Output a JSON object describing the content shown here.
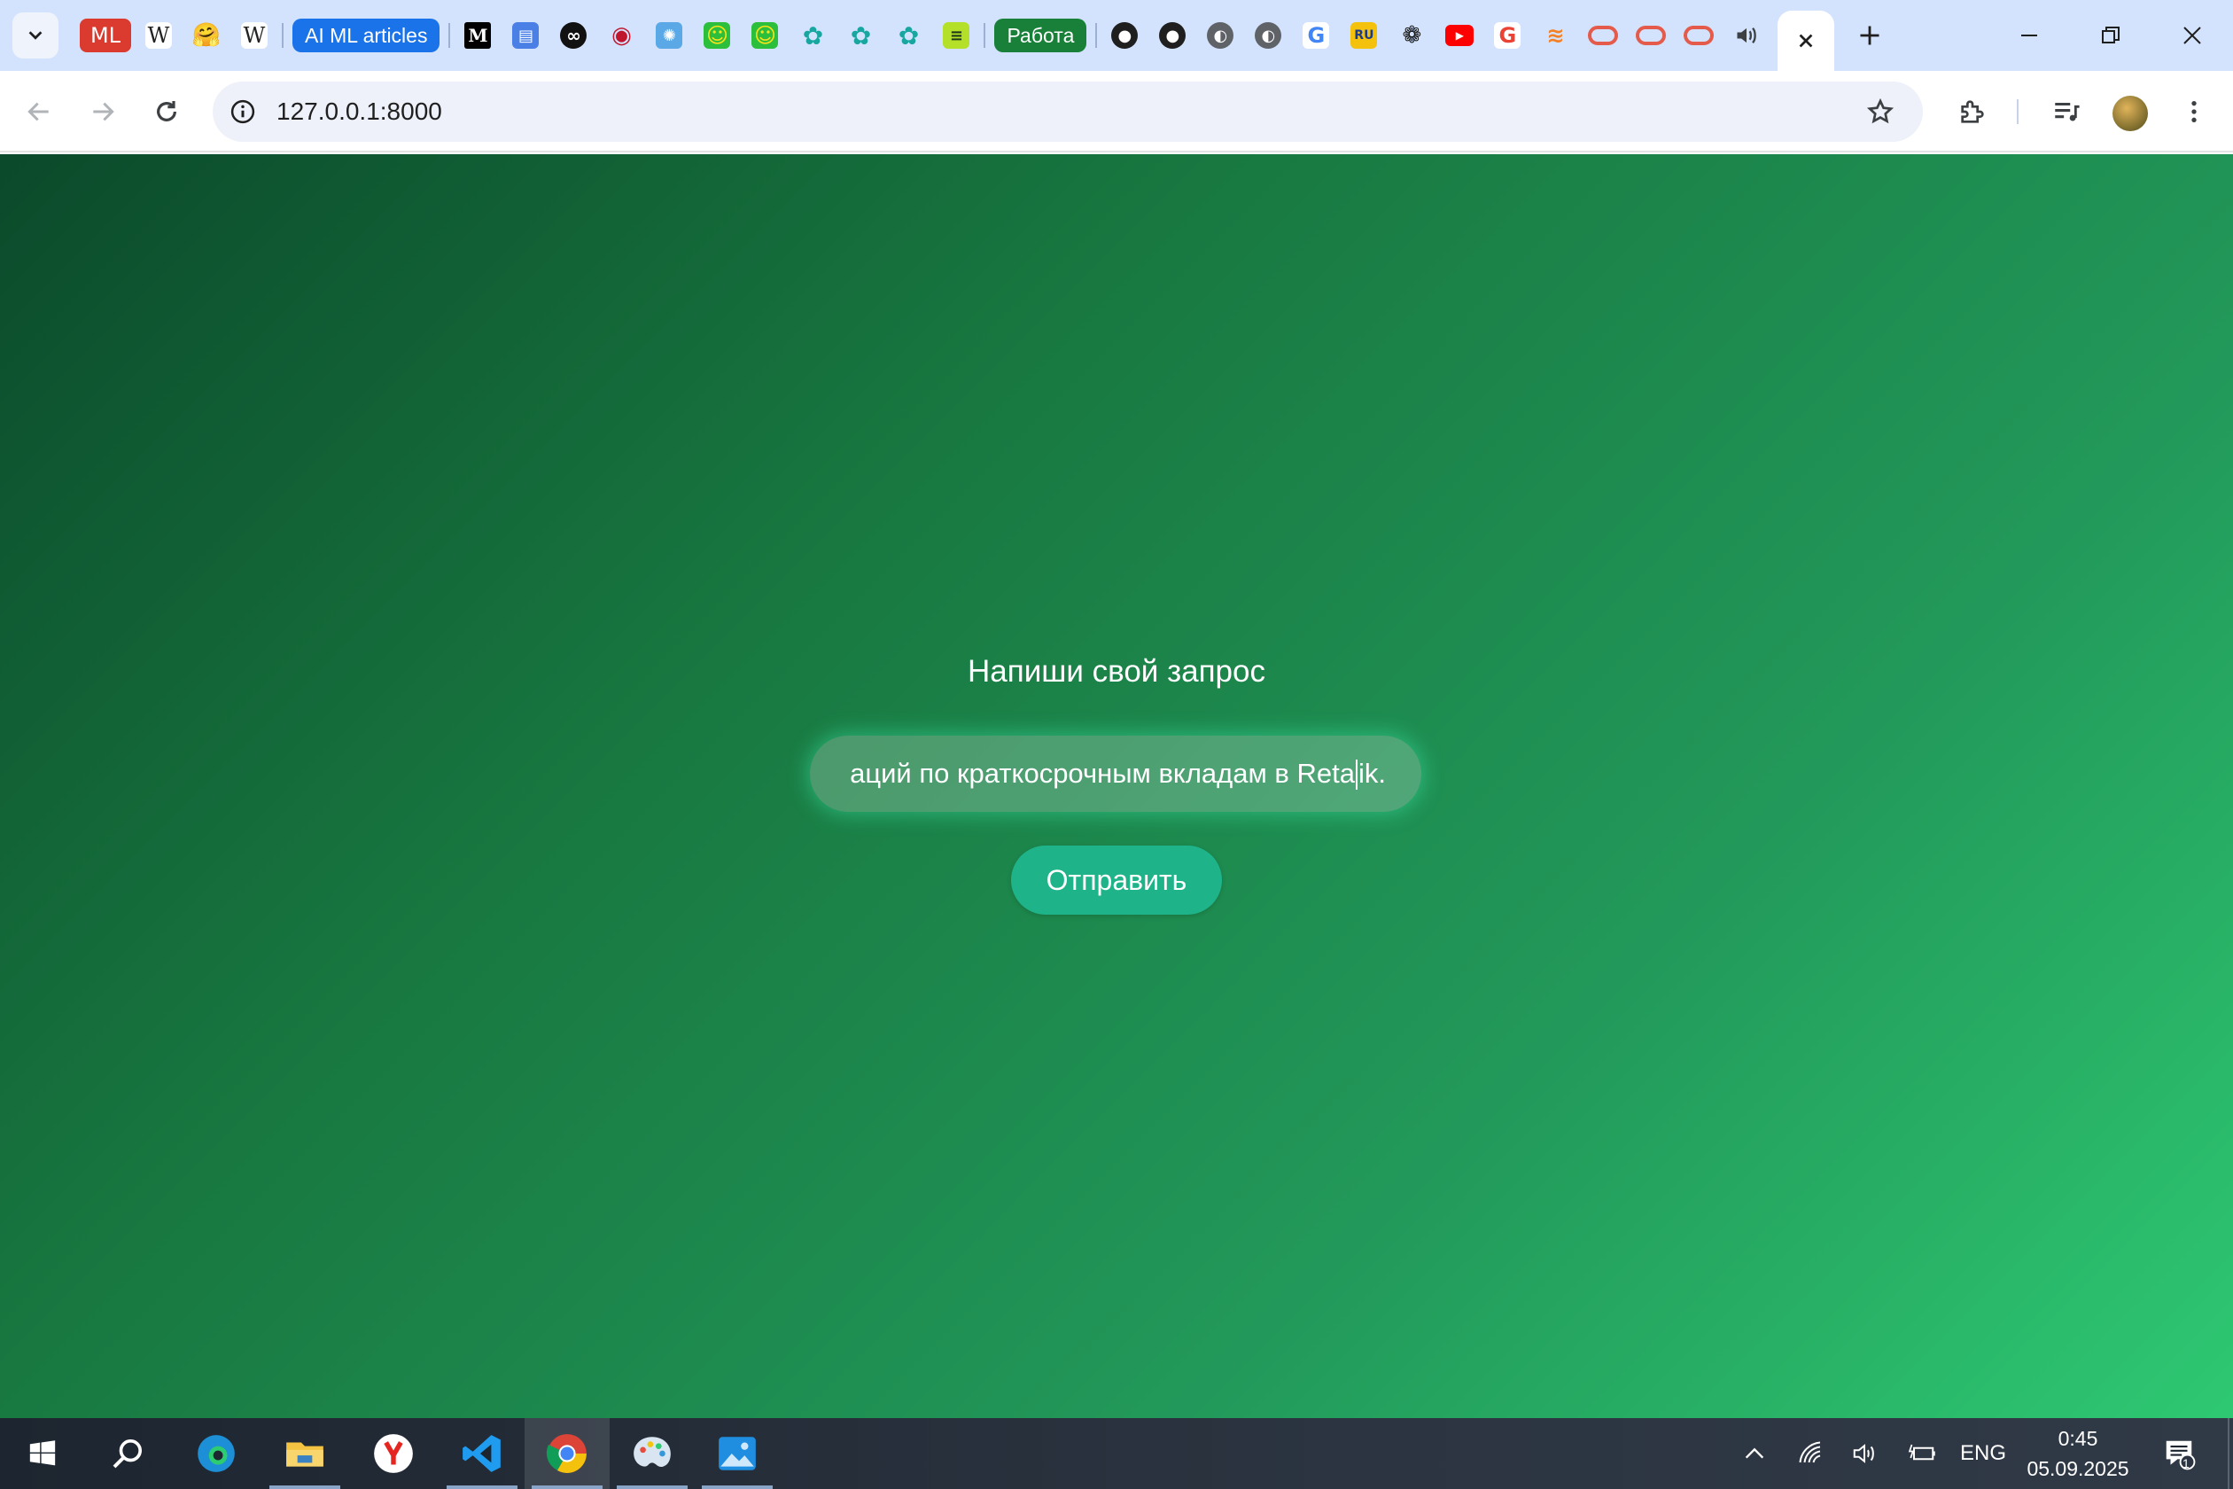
{
  "browser": {
    "tabs": {
      "ai_ml_articles": "AI ML articles",
      "rabota": "Работа",
      "ml_badge": "ML",
      "wiki_letter": "W",
      "medium_letter": "M",
      "yandex_letters": "RU",
      "google_letter": "G"
    },
    "url": "127.0.0.1:8000"
  },
  "page": {
    "title": "Напиши свой запрос",
    "input_value_before_caret": "аций по краткосрочным вкладам в Reta",
    "input_value_after_caret": "ik.",
    "send_button": "Отправить"
  },
  "taskbar": {
    "language": "ENG",
    "time": "0:45",
    "date": "05.09.2025",
    "notification_count": "1"
  }
}
